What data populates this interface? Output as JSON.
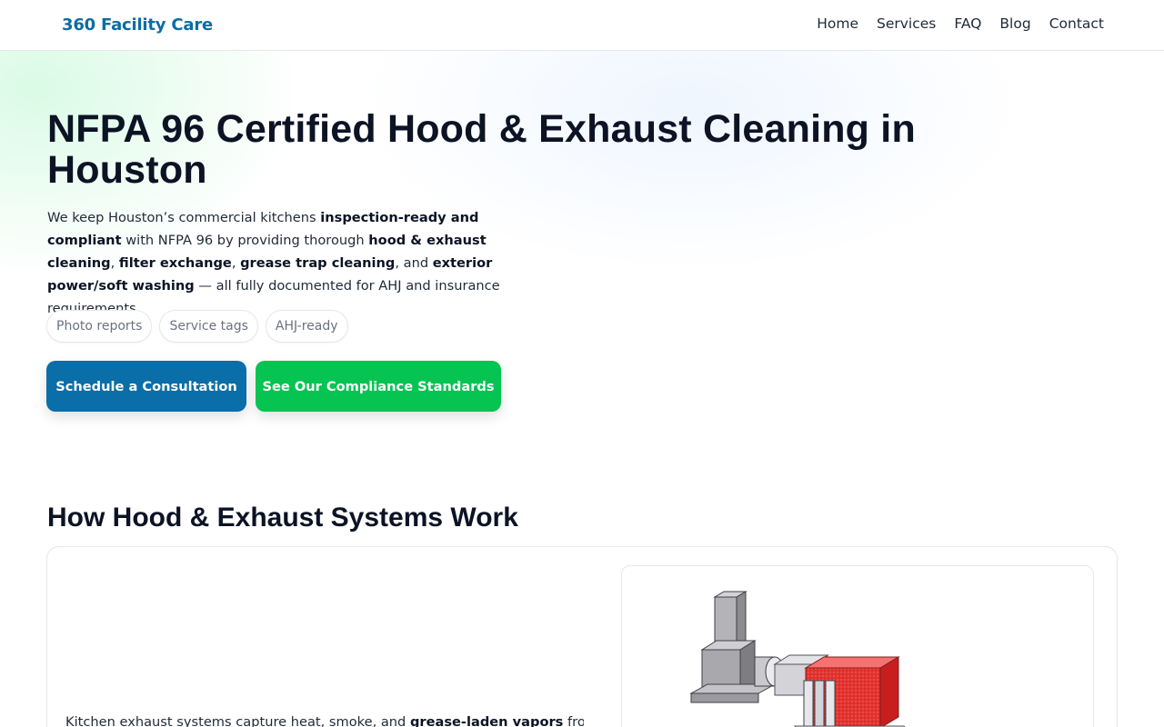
{
  "header": {
    "brand": "360 Facility Care",
    "nav": [
      "Home",
      "Services",
      "FAQ",
      "Blog",
      "Contact"
    ]
  },
  "hero": {
    "title": "NFPA 96 Certified Hood & Exhaust Cleaning in Houston",
    "description": {
      "t1": "We keep Houston’s commercial kitchens ",
      "b1": "inspection-ready and compliant",
      "t2": " with NFPA 96 by providing thorough ",
      "b2": "hood & exhaust cleaning",
      "t3": ", ",
      "b3": "filter exchange",
      "t4": ", ",
      "b4": "grease trap cleaning",
      "t5": ", and ",
      "b5": "exterior power/soft washing",
      "t6": " — all fully documented for AHJ and insurance requirements."
    },
    "chips": [
      "Photo reports",
      "Service tags",
      "AHJ-ready"
    ],
    "primary_button": "Schedule a Consultation",
    "secondary_button": "See Our Compliance Standards"
  },
  "how_it_works": {
    "title": "How Hood & Exhaust Systems Work",
    "text_start": "Kitchen exhaust systems capture heat, smoke, and ",
    "text_bold": "grease-laden vapors",
    "text_end": " from"
  },
  "colors": {
    "brand": "#0a6ea3",
    "primary_button": "#0a6ea8",
    "secondary_button": "#05c452",
    "diagram_accent": "#e3342f"
  },
  "icons": [
    "exhaust-system-diagram"
  ]
}
